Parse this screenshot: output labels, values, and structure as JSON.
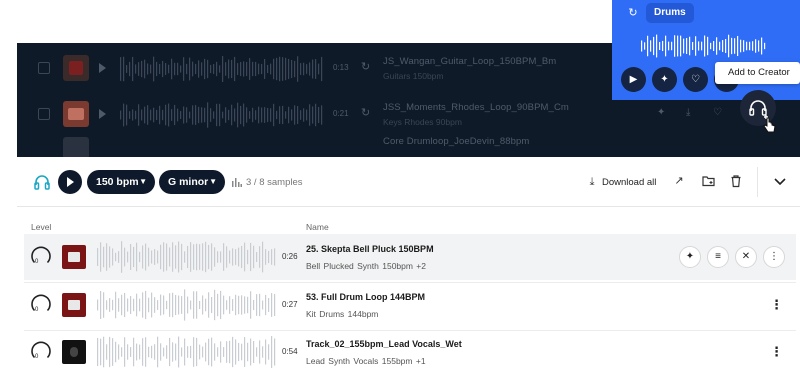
{
  "background_rows": [
    {
      "duration": "0:13",
      "name": "JS_Wangan_Guitar_Loop_150BPM_Bm",
      "tags": "Guitars  150bpm"
    },
    {
      "duration": "0:21",
      "name": "JSS_Moments_Rhodes_Loop_90BPM_Cm",
      "tags": "Keys  Rhodes  90bpm"
    },
    {
      "duration": "",
      "name": "Core Drumloop_JoeDevin_88bpm",
      "tags": ""
    }
  ],
  "popup": {
    "tag": "Drums",
    "tooltip": "Add to Creator"
  },
  "toolbar": {
    "bpm": "150 bpm",
    "key": "G minor",
    "samples": "3 / 8 samples",
    "download": "Download all"
  },
  "table": {
    "col_level": "Level",
    "col_name": "Name"
  },
  "rows": [
    {
      "level": "0",
      "duration": "0:26",
      "name": "25. Skepta Bell Pluck 150BPM",
      "tags": "Bell  Plucked  Synth  150bpm  +2"
    },
    {
      "level": "0",
      "duration": "0:27",
      "name": "53. Full Drum Loop 144BPM",
      "tags": "Kit  Drums  144bpm"
    },
    {
      "level": "0",
      "duration": "0:54",
      "name": "Track_02_155bpm_Lead Vocals_Wet",
      "tags": "Lead  Synth  Vocals  155bpm  +1"
    }
  ],
  "colors": {
    "accent": "#2f6df6",
    "dark": "#0f1a28",
    "headphones": "#1aa6c4"
  },
  "icons": [
    "loop-icon",
    "play-icon",
    "sparkle-icon",
    "heart-icon",
    "headphones-plus-icon",
    "headphones-icon",
    "chevron-down-icon",
    "bars-icon",
    "download-icon",
    "share-icon",
    "folder-add-icon",
    "trash-icon",
    "sliders-icon",
    "close-icon",
    "kebab-icon",
    "pointer-cursor-icon"
  ]
}
